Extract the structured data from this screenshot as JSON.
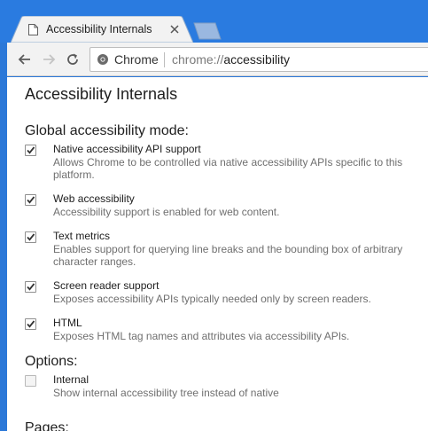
{
  "window": {
    "tab_title": "Accessibility Internals",
    "colors": {
      "titlebar": "#2a7be0",
      "toolbar": "#f2f2f2",
      "accent_check": "#333333"
    }
  },
  "toolbar": {
    "back_icon": "back-arrow-icon",
    "forward_icon": "forward-arrow-icon",
    "reload_icon": "reload-icon",
    "origin_chip": "Chrome",
    "url_scheme": "chrome://",
    "url_host": "accessibility"
  },
  "page": {
    "title": "Accessibility Internals",
    "global_mode_heading": "Global accessibility mode:",
    "global_options": [
      {
        "label": "Native accessibility API support",
        "description": "Allows Chrome to be controlled via native accessibility APIs specific to this platform.",
        "checked": true
      },
      {
        "label": "Web accessibility",
        "description": "Accessibility support is enabled for web content.",
        "checked": true
      },
      {
        "label": "Text metrics",
        "description": "Enables support for querying line breaks and the bounding box of arbitrary character ranges.",
        "checked": true
      },
      {
        "label": "Screen reader support",
        "description": "Exposes accessibility APIs typically needed only by screen readers.",
        "checked": true
      },
      {
        "label": "HTML",
        "description": "Exposes HTML tag names and attributes via accessibility APIs.",
        "checked": true
      }
    ],
    "options_heading": "Options:",
    "options": [
      {
        "label": "Internal",
        "description": "Show internal accessibility tree instead of native",
        "checked": false
      }
    ],
    "pages_heading": "Pages:"
  }
}
